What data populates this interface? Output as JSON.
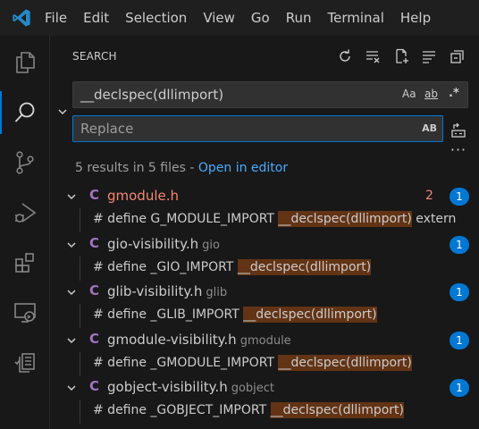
{
  "menubar": {
    "items": [
      "File",
      "Edit",
      "Selection",
      "View",
      "Go",
      "Run",
      "Terminal",
      "Help"
    ]
  },
  "activitybar": {
    "icons": [
      "explorer-icon",
      "search-icon",
      "source-control-icon",
      "run-debug-icon",
      "extensions-icon",
      "remote-explorer-icon",
      "testing-icon"
    ],
    "accent": "#0078d4"
  },
  "sidebar": {
    "title": "SEARCH",
    "toolbar_icons": [
      "refresh-icon",
      "clear-results-icon",
      "new-search-editor-icon",
      "view-as-tree-icon",
      "collapse-all-icon"
    ]
  },
  "search": {
    "value": "__declspec(dllimport)",
    "match_case_label": "Aa",
    "whole_word_label": "ab",
    "regex_label": ".*"
  },
  "replace": {
    "placeholder": "Replace",
    "preserve_case_label": "AB"
  },
  "results": {
    "summary": "5 results in 5 files - ",
    "open_in_editor": "Open in editor",
    "files": [
      {
        "name": "gmodule.h",
        "dir": "",
        "modified": true,
        "problems": "2",
        "count": "1",
        "match_prefix": "# define G_MODULE_IMPORT ",
        "match": "__declspec(dllimport)",
        "match_suffix": " extern"
      },
      {
        "name": "gio-visibility.h",
        "dir": "gio",
        "modified": false,
        "problems": "",
        "count": "1",
        "match_prefix": "# define _GIO_IMPORT ",
        "match": "__declspec(dllimport)",
        "match_suffix": ""
      },
      {
        "name": "glib-visibility.h",
        "dir": "glib",
        "modified": false,
        "problems": "",
        "count": "1",
        "match_prefix": "# define _GLIB_IMPORT ",
        "match": "__declspec(dllimport)",
        "match_suffix": ""
      },
      {
        "name": "gmodule-visibility.h",
        "dir": "gmodule",
        "modified": false,
        "problems": "",
        "count": "1",
        "match_prefix": "# define _GMODULE_IMPORT ",
        "match": "__declspec(dllimport)",
        "match_suffix": ""
      },
      {
        "name": "gobject-visibility.h",
        "dir": "gobject",
        "modified": false,
        "problems": "",
        "count": "1",
        "match_prefix": "# define _GOBJECT_IMPORT ",
        "match": "__declspec(dllimport)",
        "match_suffix": ""
      }
    ]
  },
  "colors": {
    "match_highlight": "#623315",
    "modified_file": "#f48771",
    "c_file_icon": "#a074c4",
    "badge": "#0078d4",
    "link": "#4daafc"
  }
}
